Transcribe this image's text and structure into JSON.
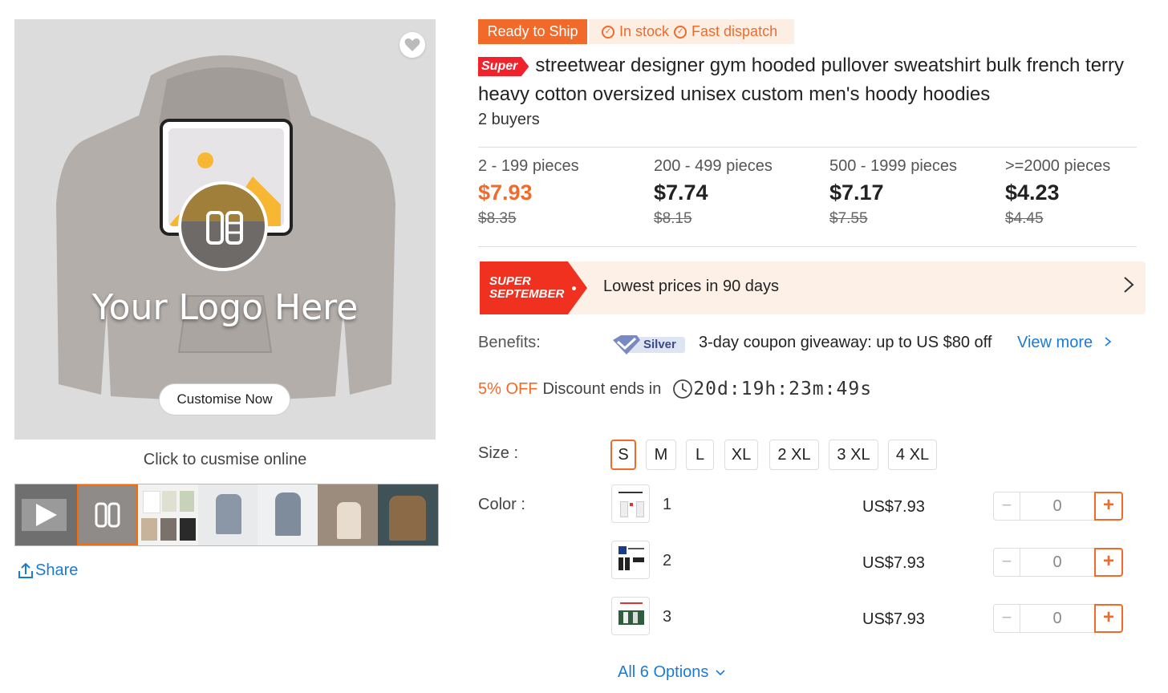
{
  "gallery": {
    "main_logo_text": "Your Logo Here",
    "customise_button": "Customise Now",
    "caption": "Click to cusmise online",
    "share_label": "Share",
    "thumbnails": [
      "video",
      "logo-customizer",
      "hoodie-colors",
      "model-front",
      "model-back",
      "model-lifestyle",
      "model-jacket"
    ]
  },
  "badges": {
    "ready": "Ready to Ship",
    "in_stock": "In stock",
    "fast_dispatch": "Fast dispatch"
  },
  "product": {
    "super_tag": "Super",
    "title": "streetwear designer gym hooded pullover sweatshirt bulk french terry heavy cotton oversized unisex custom men's hoody hoodies",
    "buyers": "2 buyers"
  },
  "price_tiers": [
    {
      "range": "2 - 199 pieces",
      "price": "$7.93",
      "old": "$8.35"
    },
    {
      "range": "200 - 499 pieces",
      "price": "$7.74",
      "old": "$8.15"
    },
    {
      "range": "500 - 1999 pieces",
      "price": "$7.17",
      "old": "$7.55"
    },
    {
      "range": ">=2000 pieces",
      "price": "$4.23",
      "old": "$4.45"
    }
  ],
  "promo": {
    "logo_line1": "SUPER",
    "logo_line2": "SEPTEMBER",
    "text": "Lowest prices in 90 days"
  },
  "benefits": {
    "label": "Benefits:",
    "badge": "Silver",
    "text": "3-day coupon giveaway: up to US $80 off",
    "view_more": "View more"
  },
  "discount": {
    "percent": "5% OFF",
    "text": "Discount ends in",
    "countdown": "20d:19h:23m:49s"
  },
  "size": {
    "label": "Size :",
    "options": [
      "S",
      "M",
      "L",
      "XL",
      "2 XL",
      "3 XL",
      "4 XL"
    ],
    "selected": "S"
  },
  "color": {
    "label": "Color :",
    "rows": [
      {
        "name": "1",
        "price": "US$7.93",
        "qty": "0"
      },
      {
        "name": "2",
        "price": "US$7.93",
        "qty": "0"
      },
      {
        "name": "3",
        "price": "US$7.93",
        "qty": "0"
      }
    ],
    "all_options": "All 6 Options"
  },
  "colors": {
    "accent": "#f26a2a",
    "link": "#1a7bd6",
    "super_red": "#f0311f"
  }
}
